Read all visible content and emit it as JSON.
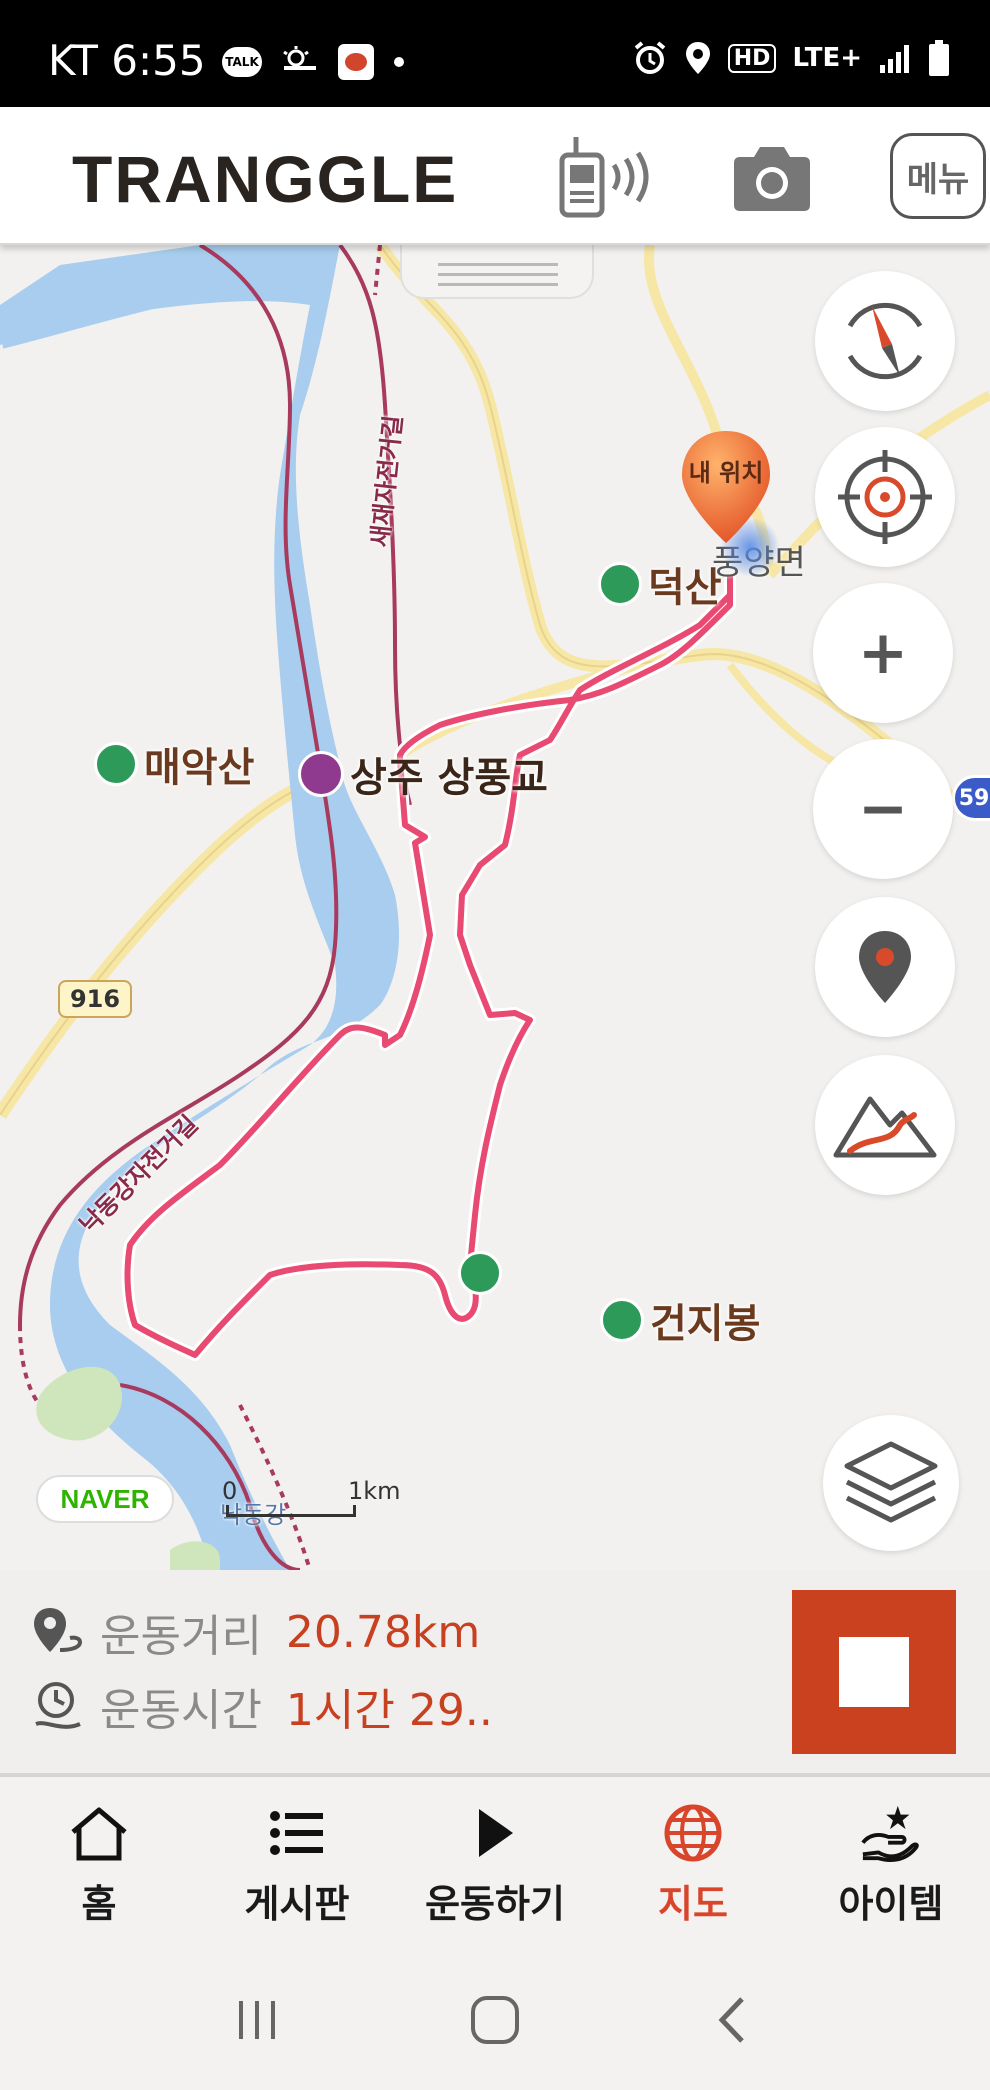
{
  "status_bar": {
    "carrier_time": "KT 6:55",
    "talk_badge": "TALK",
    "hd_badge": "HD",
    "network": "LTE+"
  },
  "header": {
    "logo": "TRANGGLE",
    "menu_label": "메뉴"
  },
  "map": {
    "my_location_label": "내 위치",
    "labels": {
      "poongyang": "풍양면",
      "deoksan": "덕산",
      "maeaksan": "매악산",
      "sangpung_bridge": "상주 상풍교",
      "geonjibong": "건지봉",
      "saejae_trail": "새재자전거길",
      "nakdong_trail": "낙동강자전거길",
      "nakdong_river": "낙동강",
      "route_916": "916",
      "route_59": "59"
    },
    "controls": {
      "zoom_in": "+",
      "zoom_out": "−"
    },
    "provider": "NAVER",
    "scale": {
      "start": "0",
      "end": "1km"
    }
  },
  "stats": {
    "distance_label": "운동거리",
    "distance_value": "20.78km",
    "time_label": "운동시간",
    "time_value": "1시간 29.."
  },
  "nav": {
    "items": [
      {
        "label": "홈",
        "icon": "home-icon",
        "active": false
      },
      {
        "label": "게시판",
        "icon": "list-icon",
        "active": false
      },
      {
        "label": "운동하기",
        "icon": "play-icon",
        "active": false
      },
      {
        "label": "지도",
        "icon": "globe-icon",
        "active": true
      },
      {
        "label": "아이템",
        "icon": "item-hand-icon",
        "active": false
      }
    ]
  },
  "colors": {
    "accent": "#c9411f",
    "route": "#e84a72",
    "river": "#a8cdee",
    "road": "#f7e7a6",
    "trail": "#a83a5e"
  }
}
